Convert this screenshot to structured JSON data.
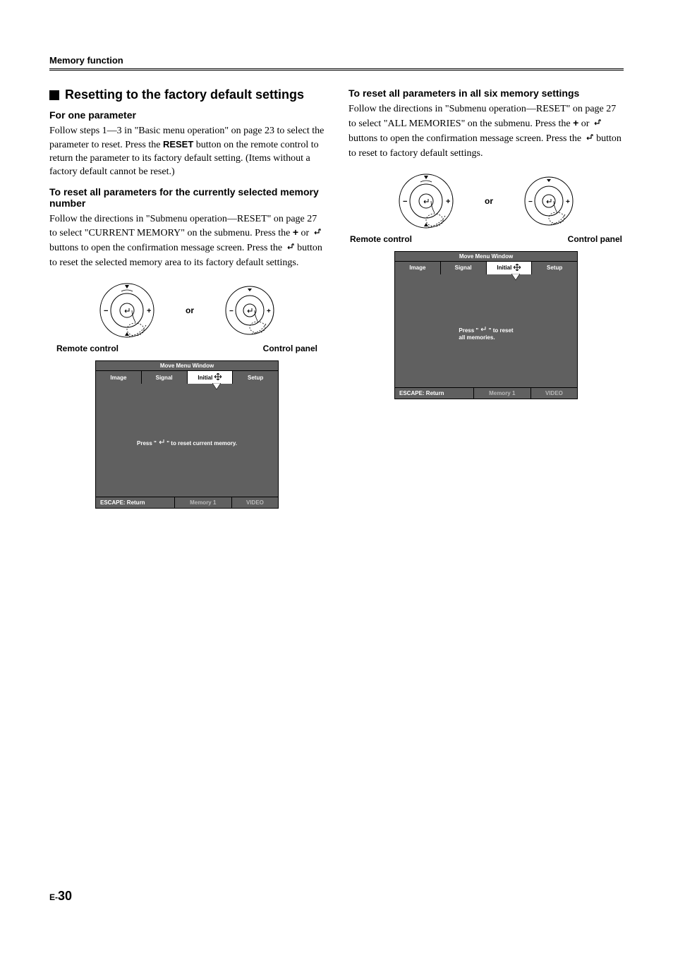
{
  "runningHead": "Memory function",
  "left": {
    "heading": "Resetting to the factory default settings",
    "sub1": "For one parameter",
    "p1a": "Follow steps 1—3 in \"Basic menu operation\" on page 23 to select the parameter to reset. Press the ",
    "p1reset": "RESET",
    "p1b": " button on the remote control to return the parameter to its factory default setting. (Items without a factory default cannot be reset.)",
    "sub2": "To reset all parameters for the currently selected memory number",
    "p2a": "Follow the directions in \"Submenu operation—RESET\" on page 27 to select \"CURRENT MEMORY\" on the submenu. Press the ",
    "p2plus": "+",
    "p2b": " or ",
    "p2c": " buttons to open the confirmation message screen. Press the ",
    "p2d": " button to reset the selected memory area to its factory default settings.",
    "or": "or",
    "capRemote": "Remote control",
    "capPanel": "Control panel",
    "osd": {
      "top": "Move Menu Window",
      "tabs": [
        "Image",
        "Signal",
        "Initial",
        "Setup"
      ],
      "bodyPrefix": "Press \" ",
      "bodySuffix": " \" to reset current memory.",
      "escape": "ESCAPE: Return",
      "memory": "Memory 1",
      "video": "VIDEO"
    }
  },
  "right": {
    "sub1": "To reset all parameters in all six memory settings",
    "p1a": "Follow the directions in \"Submenu operation—RESET\" on page 27 to select \"ALL MEMORIES\" on the submenu. Press the ",
    "p1plus": "+",
    "p1b": " or ",
    "p1c": " buttons to open the confirmation message screen. Press the ",
    "p1d": " button to reset to factory default settings.",
    "or": "or",
    "capRemote": "Remote control",
    "capPanel": "Control panel",
    "osd": {
      "top": "Move Menu Window",
      "tabs": [
        "Image",
        "Signal",
        "Initial",
        "Setup"
      ],
      "bodyLine1Prefix": "Press \" ",
      "bodyLine1Suffix": " \" to reset",
      "bodyLine2": "all memories.",
      "escape": "ESCAPE: Return",
      "memory": "Memory 1",
      "video": "VIDEO"
    }
  },
  "pageNum": {
    "prefix": "E-",
    "num": "30"
  }
}
